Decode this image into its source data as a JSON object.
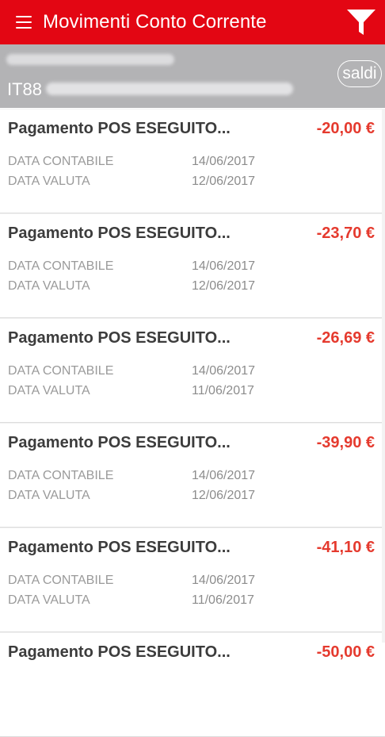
{
  "header": {
    "title": "Movimenti Conto Corrente"
  },
  "account": {
    "iban_prefix": "IT88",
    "saldi_label": "saldi"
  },
  "labels": {
    "data_contabile": "DATA CONTABILE",
    "data_valuta": "DATA VALUTA"
  },
  "transactions": [
    {
      "description": "Pagamento POS ESEGUITO...",
      "amount": "-20,00 €",
      "data_contabile": "14/06/2017",
      "data_valuta": "12/06/2017"
    },
    {
      "description": "Pagamento POS ESEGUITO...",
      "amount": "-23,70 €",
      "data_contabile": "14/06/2017",
      "data_valuta": "12/06/2017"
    },
    {
      "description": "Pagamento POS ESEGUITO...",
      "amount": "-26,69 €",
      "data_contabile": "14/06/2017",
      "data_valuta": "11/06/2017"
    },
    {
      "description": "Pagamento POS ESEGUITO...",
      "amount": "-39,90 €",
      "data_contabile": "14/06/2017",
      "data_valuta": "12/06/2017"
    },
    {
      "description": "Pagamento POS ESEGUITO...",
      "amount": "-41,10 €",
      "data_contabile": "14/06/2017",
      "data_valuta": "11/06/2017"
    },
    {
      "description": "Pagamento POS ESEGUITO...",
      "amount": "-50,00 €",
      "data_contabile": "",
      "data_valuta": ""
    }
  ],
  "icons": {
    "menu": "hamburger-menu-icon",
    "filter": "filter-funnel-icon"
  },
  "colors": {
    "brand": "#e30613",
    "account_bar": "#b3b3b5",
    "amount": "#e53a2e"
  }
}
